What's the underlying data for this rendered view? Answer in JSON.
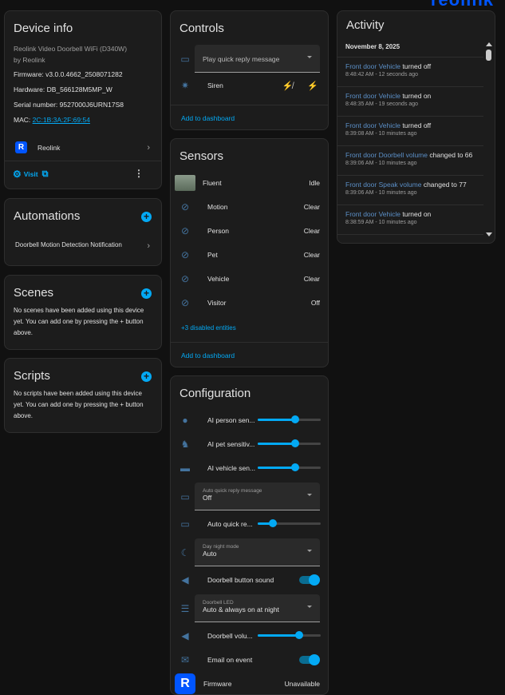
{
  "brand": {
    "logo_text": "reolink",
    "color": "#0055ff"
  },
  "device_info": {
    "title": "Device info",
    "model": "Reolink Video Doorbell WiFi (D340W)",
    "by": "by Reolink",
    "firmware": "Firmware: v3.0.0.4662_2508071282",
    "hardware": "Hardware: DB_566128M5MP_W",
    "serial": "Serial number: 9527000J6URN17S8",
    "mac_label": "MAC: ",
    "mac": "2C:1B:3A:2F:69:54",
    "integration": "Reolink",
    "visit": "Visit"
  },
  "automations": {
    "title": "Automations",
    "items": [
      "Doorbell Motion Detection Notification"
    ]
  },
  "scenes": {
    "title": "Scenes",
    "empty": "No scenes have been added using this device yet. You can add one by pressing the + button above."
  },
  "scripts": {
    "title": "Scripts",
    "empty": "No scripts have been added using this device yet. You can add one by pressing the + button above."
  },
  "controls": {
    "title": "Controls",
    "quick_reply": "Play quick reply message",
    "siren": "Siren",
    "add": "Add to dashboard"
  },
  "sensors": {
    "title": "Sensors",
    "items": [
      {
        "name": "Fluent",
        "state": "Idle",
        "icon": "camera-thumbnail"
      },
      {
        "name": "Motion",
        "state": "Clear",
        "icon": "motion-off-icon"
      },
      {
        "name": "Person",
        "state": "Clear",
        "icon": "person-off-icon"
      },
      {
        "name": "Pet",
        "state": "Clear",
        "icon": "paw-off-icon"
      },
      {
        "name": "Vehicle",
        "state": "Clear",
        "icon": "car-off-icon"
      },
      {
        "name": "Visitor",
        "state": "Off",
        "icon": "doorbell-icon"
      }
    ],
    "disabled": "+3 disabled entities",
    "add": "Add to dashboard"
  },
  "configuration": {
    "title": "Configuration",
    "ai_person": {
      "label": "AI person sen...",
      "value_pct": 60
    },
    "ai_pet": {
      "label": "AI pet sensitiv...",
      "value_pct": 60
    },
    "ai_vehicle": {
      "label": "AI vehicle sen...",
      "value_pct": 60
    },
    "auto_reply_msg": {
      "label": "Auto quick reply message",
      "value": "Off"
    },
    "auto_reply_time": {
      "label": "Auto quick re...",
      "value_pct": 24
    },
    "day_night": {
      "label": "Day night mode",
      "value": "Auto"
    },
    "button_sound": {
      "label": "Doorbell button sound",
      "on": true
    },
    "led": {
      "label": "Doorbell LED",
      "value": "Auto & always on at night"
    },
    "volume": {
      "label": "Doorbell volu...",
      "value_pct": 66
    },
    "email": {
      "label": "Email on event",
      "on": true
    },
    "firmware": {
      "label": "Firmware",
      "value": "Unavailable"
    }
  },
  "activity": {
    "title": "Activity",
    "date": "November 8, 2025",
    "items": [
      {
        "entity": "Front door Vehicle",
        "action": "turned off",
        "time": "8:48:42 AM - 12 seconds ago"
      },
      {
        "entity": "Front door Vehicle",
        "action": "turned on",
        "time": "8:48:35 AM - 19 seconds ago"
      },
      {
        "entity": "Front door Vehicle",
        "action": "turned off",
        "time": "8:39:08 AM - 10 minutes ago"
      },
      {
        "entity": "Front door Doorbell volume",
        "action": "changed to 66",
        "time": "8:39:06 AM - 10 minutes ago"
      },
      {
        "entity": "Front door Speak volume",
        "action": "changed to 77",
        "time": "8:39:06 AM - 10 minutes ago"
      },
      {
        "entity": "Front door Vehicle",
        "action": "turned on",
        "time": "8:38:59 AM - 10 minutes ago"
      }
    ]
  }
}
